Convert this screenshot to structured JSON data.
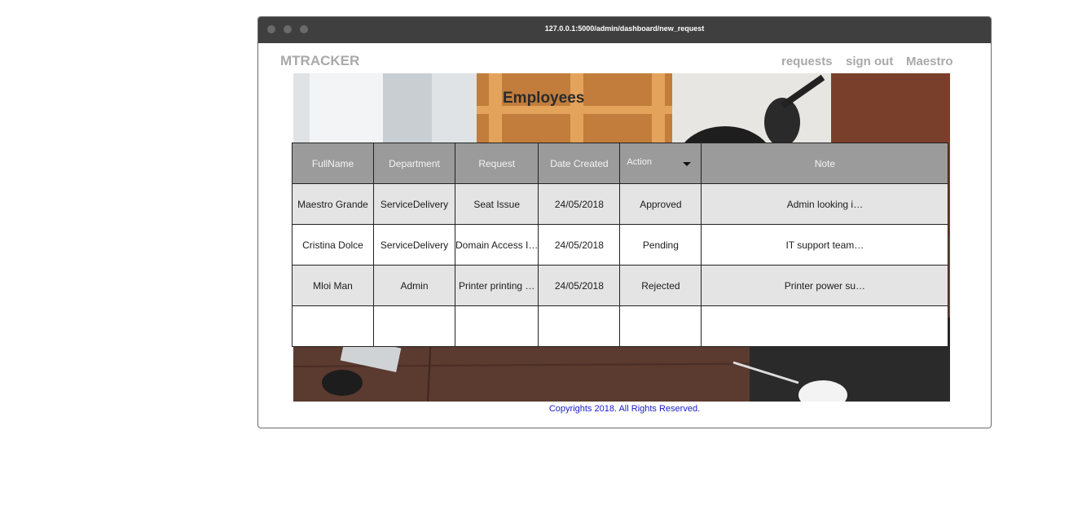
{
  "browser": {
    "url": "127.0.0.1:5000/admin/dashboard/new_request"
  },
  "header": {
    "brand": "MTRACKER",
    "nav": {
      "requests": "requests",
      "sign_out": "sign out",
      "user": "Maestro"
    }
  },
  "page": {
    "title": "Employees"
  },
  "table": {
    "columns": {
      "fullname": "FullName",
      "department": "Department",
      "request": "Request",
      "date_created": "Date Created",
      "action": "Action",
      "note": "Note"
    },
    "rows": [
      {
        "fullname": "Maestro Grande",
        "department": "ServiceDelivery",
        "request": "Seat Issue",
        "date": "24/05/2018",
        "status": "Approved",
        "note": "Admin looking i…"
      },
      {
        "fullname": "Cristina Dolce",
        "department": "ServiceDelivery",
        "request": "Domain Access I…",
        "date": "24/05/2018",
        "status": "Pending",
        "note": "IT support team…"
      },
      {
        "fullname": "Mloi Man",
        "department": "Admin",
        "request": "Printer printing …",
        "date": "24/05/2018",
        "status": "Rejected",
        "note": "Printer power su…"
      }
    ]
  },
  "footer": {
    "text": "Copyrights  2018. All Rights Reserved."
  },
  "colors": {
    "titlebar": "#3f3f3f",
    "header_bg": "#9b9b9b",
    "row_alt": "#e4e4e4",
    "footer_link": "#1a1ad0",
    "brand": "#a9a9a9"
  }
}
